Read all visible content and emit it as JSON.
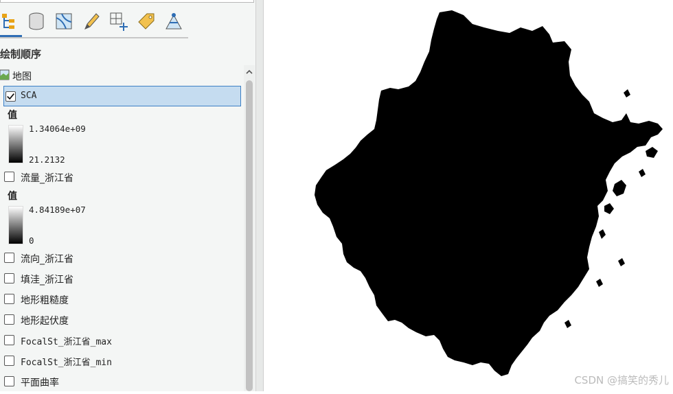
{
  "toolbar": {
    "buttons": [
      {
        "name": "list-by-drawing-order-icon",
        "selected": true
      },
      {
        "name": "list-by-data-source-icon"
      },
      {
        "name": "list-by-source-type-icon"
      },
      {
        "name": "list-by-editing-icon"
      },
      {
        "name": "list-by-selection-icon"
      },
      {
        "name": "list-by-labeling-icon"
      },
      {
        "name": "list-by-snapping-icon"
      }
    ]
  },
  "contents": {
    "section_title": "绘制顺序",
    "map_label": "地图",
    "layers": [
      {
        "name": "SCA",
        "checked": true,
        "selected": true,
        "legend": {
          "title": "值",
          "high": "1.34064e+09",
          "low": "21.2132"
        }
      },
      {
        "name": "流量_浙江省",
        "checked": false,
        "legend": {
          "title": "值",
          "high": "4.84189e+07",
          "low": "0"
        }
      },
      {
        "name": "流向_浙江省",
        "checked": false
      },
      {
        "name": "填洼_浙江省",
        "checked": false
      },
      {
        "name": "地形粗糙度",
        "checked": false
      },
      {
        "name": "地形起伏度",
        "checked": false
      },
      {
        "name": "FocalSt_浙江省_max",
        "checked": false
      },
      {
        "name": "FocalSt_浙江省_min",
        "checked": false
      },
      {
        "name": "平面曲率",
        "checked": false
      }
    ]
  },
  "watermark": "CSDN @搞笑的秀儿",
  "colors": {
    "selection_bg": "#c5dcf0",
    "selection_border": "#3b7fc4",
    "accent": "#2e6db4",
    "map_fill": "#000000"
  }
}
